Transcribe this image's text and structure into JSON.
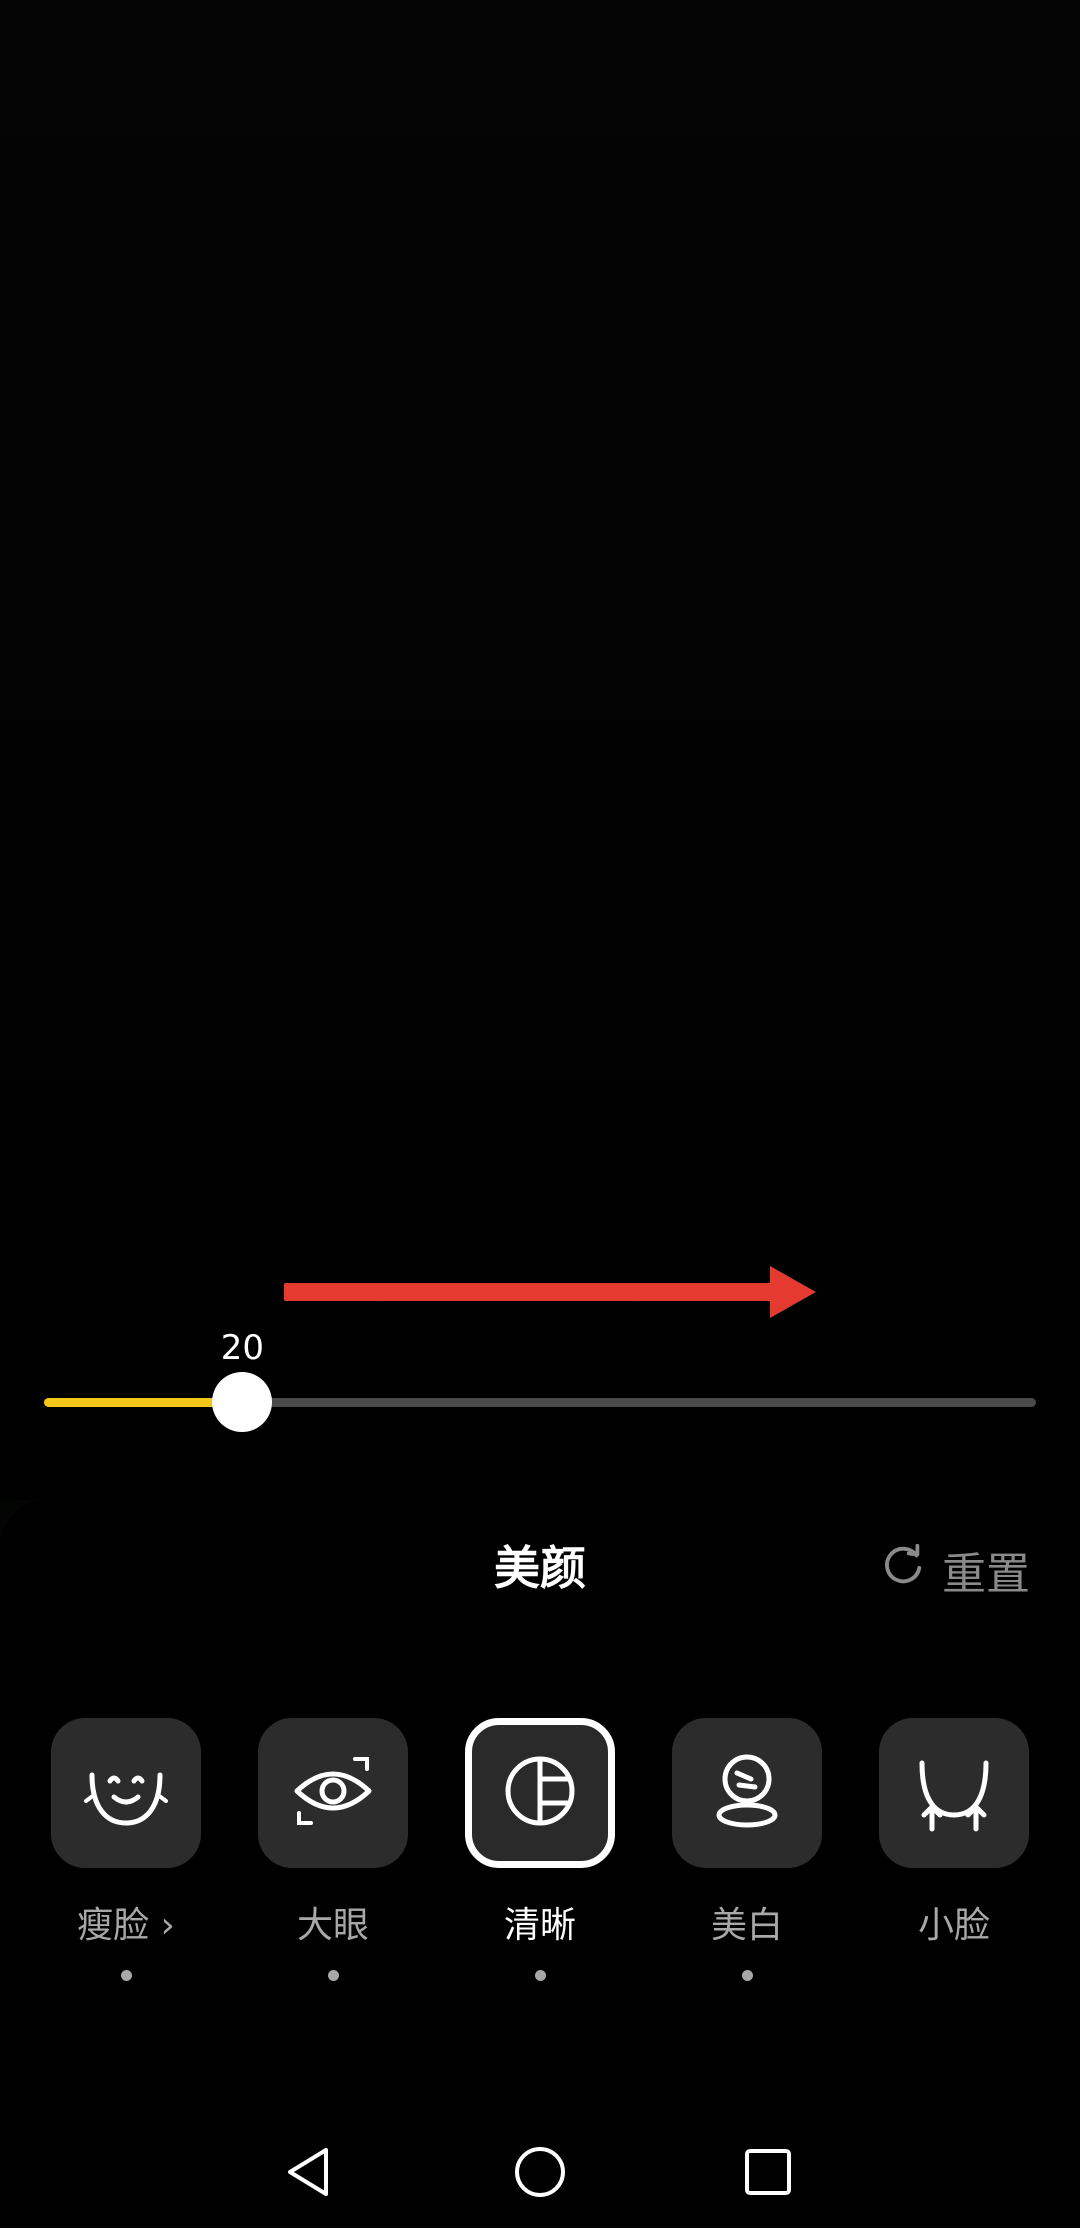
{
  "slider": {
    "value": "20",
    "fraction": 0.2
  },
  "panel": {
    "title": "美颜",
    "reset_label": "重置"
  },
  "features": [
    {
      "label": "瘦脸",
      "suffix": "›",
      "selected": false,
      "dot": true,
      "icon": "face-slim-icon"
    },
    {
      "label": "大眼",
      "suffix": "",
      "selected": false,
      "dot": true,
      "icon": "eye-icon"
    },
    {
      "label": "清晰",
      "suffix": "",
      "selected": true,
      "dot": true,
      "icon": "clarity-icon"
    },
    {
      "label": "美白",
      "suffix": "",
      "selected": false,
      "dot": true,
      "icon": "whiten-icon"
    },
    {
      "label": "小脸",
      "suffix": "",
      "selected": false,
      "dot": false,
      "icon": "small-face-icon"
    }
  ],
  "colors": {
    "accent": "#f2c71a",
    "annotation": "#e43a2f"
  }
}
